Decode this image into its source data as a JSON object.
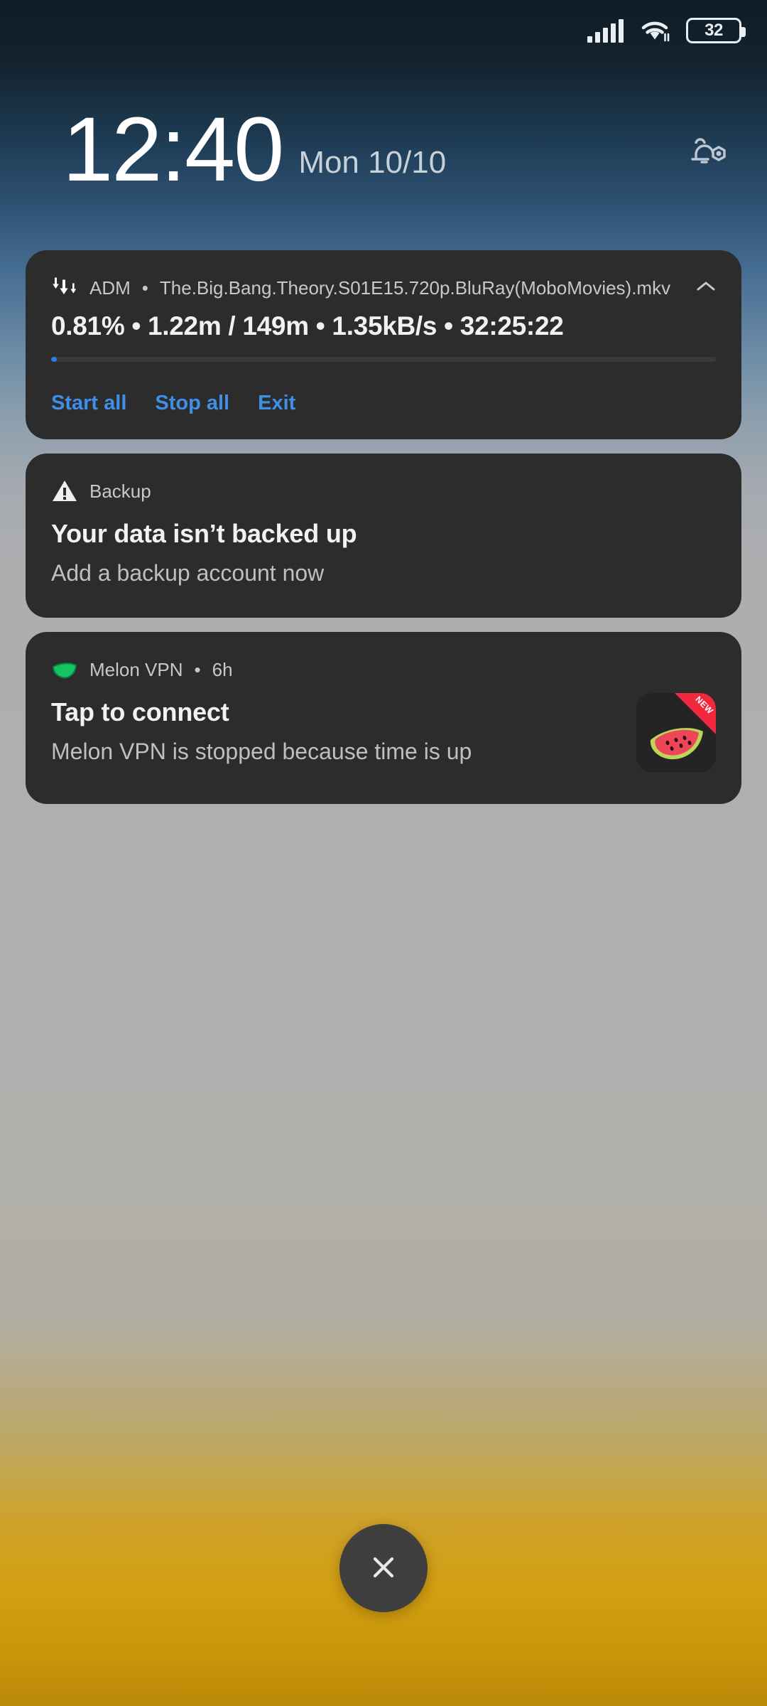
{
  "status_bar": {
    "signal_icon": "cellular-signal-icon",
    "signal_bars": 5,
    "wifi_icon": "wifi-icon",
    "battery_icon": "battery-icon",
    "battery_level": "32"
  },
  "lockscreen": {
    "time": "12:40",
    "date": "Mon 10/10",
    "settings_icon": "bell-gear-icon"
  },
  "notifications": [
    {
      "id": "adm-download",
      "app_icon": "download-arrows-icon",
      "app_name": "ADM",
      "separator": "•",
      "file_name": "The.Big.Bang.Theory.S01E15.720p.BluRay(MoboMovies).mkv",
      "expand_icon": "chevron-up-icon",
      "progress_text": "0.81% • 1.22m / 149m • 1.35kB/s • 32:25:22",
      "progress_percent": 0.81,
      "progress_color": "#2b7fe0",
      "actions": [
        {
          "label": "Start all",
          "name": "start-all-button"
        },
        {
          "label": "Stop all",
          "name": "stop-all-button"
        },
        {
          "label": "Exit",
          "name": "exit-button"
        }
      ]
    },
    {
      "id": "backup-warning",
      "app_icon": "warning-triangle-icon",
      "app_name": "Backup",
      "title": "Your data isn’t backed up",
      "subtitle": "Add a backup account now"
    },
    {
      "id": "melon-vpn",
      "app_icon": "green-melon-leaf-icon",
      "app_name": "Melon VPN",
      "separator": "•",
      "timestamp": "6h",
      "title": "Tap to connect",
      "subtitle": "Melon VPN is stopped because time is up",
      "thumbnail_icon": "watermelon-app-icon",
      "thumbnail_badge": "NEW"
    }
  ],
  "footer": {
    "clear_all_icon": "close-x-icon",
    "clear_all_label": "Clear all notifications"
  },
  "colors": {
    "card_background": "#2c2c2c",
    "accent_blue": "#3f8ee8",
    "badge_red": "#f0293d",
    "melon_green": "#1bc46a",
    "bottom_gold": "#d3a013"
  }
}
